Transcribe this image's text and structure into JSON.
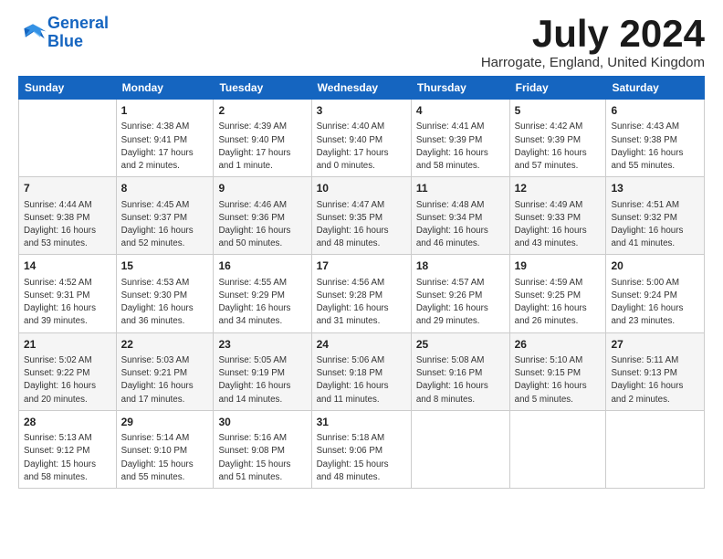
{
  "header": {
    "logo_line1": "General",
    "logo_line2": "Blue",
    "month": "July 2024",
    "location": "Harrogate, England, United Kingdom"
  },
  "weekdays": [
    "Sunday",
    "Monday",
    "Tuesday",
    "Wednesday",
    "Thursday",
    "Friday",
    "Saturday"
  ],
  "weeks": [
    [
      {
        "day": "",
        "content": ""
      },
      {
        "day": "1",
        "content": "Sunrise: 4:38 AM\nSunset: 9:41 PM\nDaylight: 17 hours\nand 2 minutes."
      },
      {
        "day": "2",
        "content": "Sunrise: 4:39 AM\nSunset: 9:40 PM\nDaylight: 17 hours\nand 1 minute."
      },
      {
        "day": "3",
        "content": "Sunrise: 4:40 AM\nSunset: 9:40 PM\nDaylight: 17 hours\nand 0 minutes."
      },
      {
        "day": "4",
        "content": "Sunrise: 4:41 AM\nSunset: 9:39 PM\nDaylight: 16 hours\nand 58 minutes."
      },
      {
        "day": "5",
        "content": "Sunrise: 4:42 AM\nSunset: 9:39 PM\nDaylight: 16 hours\nand 57 minutes."
      },
      {
        "day": "6",
        "content": "Sunrise: 4:43 AM\nSunset: 9:38 PM\nDaylight: 16 hours\nand 55 minutes."
      }
    ],
    [
      {
        "day": "7",
        "content": "Sunrise: 4:44 AM\nSunset: 9:38 PM\nDaylight: 16 hours\nand 53 minutes."
      },
      {
        "day": "8",
        "content": "Sunrise: 4:45 AM\nSunset: 9:37 PM\nDaylight: 16 hours\nand 52 minutes."
      },
      {
        "day": "9",
        "content": "Sunrise: 4:46 AM\nSunset: 9:36 PM\nDaylight: 16 hours\nand 50 minutes."
      },
      {
        "day": "10",
        "content": "Sunrise: 4:47 AM\nSunset: 9:35 PM\nDaylight: 16 hours\nand 48 minutes."
      },
      {
        "day": "11",
        "content": "Sunrise: 4:48 AM\nSunset: 9:34 PM\nDaylight: 16 hours\nand 46 minutes."
      },
      {
        "day": "12",
        "content": "Sunrise: 4:49 AM\nSunset: 9:33 PM\nDaylight: 16 hours\nand 43 minutes."
      },
      {
        "day": "13",
        "content": "Sunrise: 4:51 AM\nSunset: 9:32 PM\nDaylight: 16 hours\nand 41 minutes."
      }
    ],
    [
      {
        "day": "14",
        "content": "Sunrise: 4:52 AM\nSunset: 9:31 PM\nDaylight: 16 hours\nand 39 minutes."
      },
      {
        "day": "15",
        "content": "Sunrise: 4:53 AM\nSunset: 9:30 PM\nDaylight: 16 hours\nand 36 minutes."
      },
      {
        "day": "16",
        "content": "Sunrise: 4:55 AM\nSunset: 9:29 PM\nDaylight: 16 hours\nand 34 minutes."
      },
      {
        "day": "17",
        "content": "Sunrise: 4:56 AM\nSunset: 9:28 PM\nDaylight: 16 hours\nand 31 minutes."
      },
      {
        "day": "18",
        "content": "Sunrise: 4:57 AM\nSunset: 9:26 PM\nDaylight: 16 hours\nand 29 minutes."
      },
      {
        "day": "19",
        "content": "Sunrise: 4:59 AM\nSunset: 9:25 PM\nDaylight: 16 hours\nand 26 minutes."
      },
      {
        "day": "20",
        "content": "Sunrise: 5:00 AM\nSunset: 9:24 PM\nDaylight: 16 hours\nand 23 minutes."
      }
    ],
    [
      {
        "day": "21",
        "content": "Sunrise: 5:02 AM\nSunset: 9:22 PM\nDaylight: 16 hours\nand 20 minutes."
      },
      {
        "day": "22",
        "content": "Sunrise: 5:03 AM\nSunset: 9:21 PM\nDaylight: 16 hours\nand 17 minutes."
      },
      {
        "day": "23",
        "content": "Sunrise: 5:05 AM\nSunset: 9:19 PM\nDaylight: 16 hours\nand 14 minutes."
      },
      {
        "day": "24",
        "content": "Sunrise: 5:06 AM\nSunset: 9:18 PM\nDaylight: 16 hours\nand 11 minutes."
      },
      {
        "day": "25",
        "content": "Sunrise: 5:08 AM\nSunset: 9:16 PM\nDaylight: 16 hours\nand 8 minutes."
      },
      {
        "day": "26",
        "content": "Sunrise: 5:10 AM\nSunset: 9:15 PM\nDaylight: 16 hours\nand 5 minutes."
      },
      {
        "day": "27",
        "content": "Sunrise: 5:11 AM\nSunset: 9:13 PM\nDaylight: 16 hours\nand 2 minutes."
      }
    ],
    [
      {
        "day": "28",
        "content": "Sunrise: 5:13 AM\nSunset: 9:12 PM\nDaylight: 15 hours\nand 58 minutes."
      },
      {
        "day": "29",
        "content": "Sunrise: 5:14 AM\nSunset: 9:10 PM\nDaylight: 15 hours\nand 55 minutes."
      },
      {
        "day": "30",
        "content": "Sunrise: 5:16 AM\nSunset: 9:08 PM\nDaylight: 15 hours\nand 51 minutes."
      },
      {
        "day": "31",
        "content": "Sunrise: 5:18 AM\nSunset: 9:06 PM\nDaylight: 15 hours\nand 48 minutes."
      },
      {
        "day": "",
        "content": ""
      },
      {
        "day": "",
        "content": ""
      },
      {
        "day": "",
        "content": ""
      }
    ]
  ]
}
